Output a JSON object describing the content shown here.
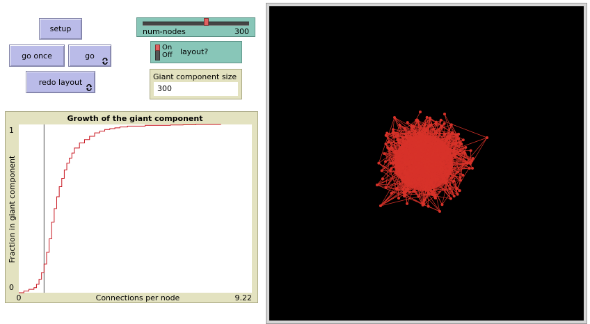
{
  "buttons": {
    "setup": "setup",
    "go_once": "go once",
    "go": "go",
    "redo_layout": "redo layout"
  },
  "slider": {
    "label": "num-nodes",
    "value": "300",
    "fraction": 0.6
  },
  "switch": {
    "on_label": "On",
    "off_label": "Off",
    "label": "layout?",
    "state": "on"
  },
  "monitor": {
    "label": "Giant component size",
    "value": "300"
  },
  "colors": {
    "button": "#babbe8",
    "widget": "#88c6b8",
    "plot_frame": "#e3e2c0",
    "network": "#d73229",
    "view_bg": "#000000"
  },
  "chart_data": {
    "type": "line",
    "title": "Growth of the giant component",
    "xlabel": "Connections per node",
    "ylabel": "Fraction in giant component",
    "x_tick_labels": [
      "0",
      "9.22"
    ],
    "y_tick_labels": [
      "0",
      "1"
    ],
    "xlim": [
      0,
      9.22
    ],
    "ylim": [
      0,
      1
    ],
    "vline_x": 1,
    "series": [
      {
        "color": "#c8141e",
        "x": [
          0,
          0.2,
          0.4,
          0.6,
          0.7,
          0.8,
          0.9,
          1.0,
          1.1,
          1.2,
          1.3,
          1.4,
          1.5,
          1.6,
          1.7,
          1.8,
          1.9,
          2.0,
          2.1,
          2.2,
          2.4,
          2.6,
          2.8,
          3.0,
          3.2,
          3.4,
          3.6,
          3.8,
          4.0,
          4.3,
          4.6,
          5.0,
          5.5,
          6.0,
          6.5,
          7.0,
          7.5,
          8.0
        ],
        "y": [
          0.0,
          0.01,
          0.02,
          0.03,
          0.05,
          0.08,
          0.12,
          0.17,
          0.24,
          0.32,
          0.42,
          0.5,
          0.57,
          0.63,
          0.68,
          0.73,
          0.77,
          0.8,
          0.83,
          0.86,
          0.89,
          0.91,
          0.93,
          0.95,
          0.96,
          0.97,
          0.975,
          0.98,
          0.985,
          0.99,
          0.99,
          0.995,
          0.995,
          0.997,
          0.998,
          1.0,
          1.0,
          1.0
        ]
      }
    ]
  }
}
